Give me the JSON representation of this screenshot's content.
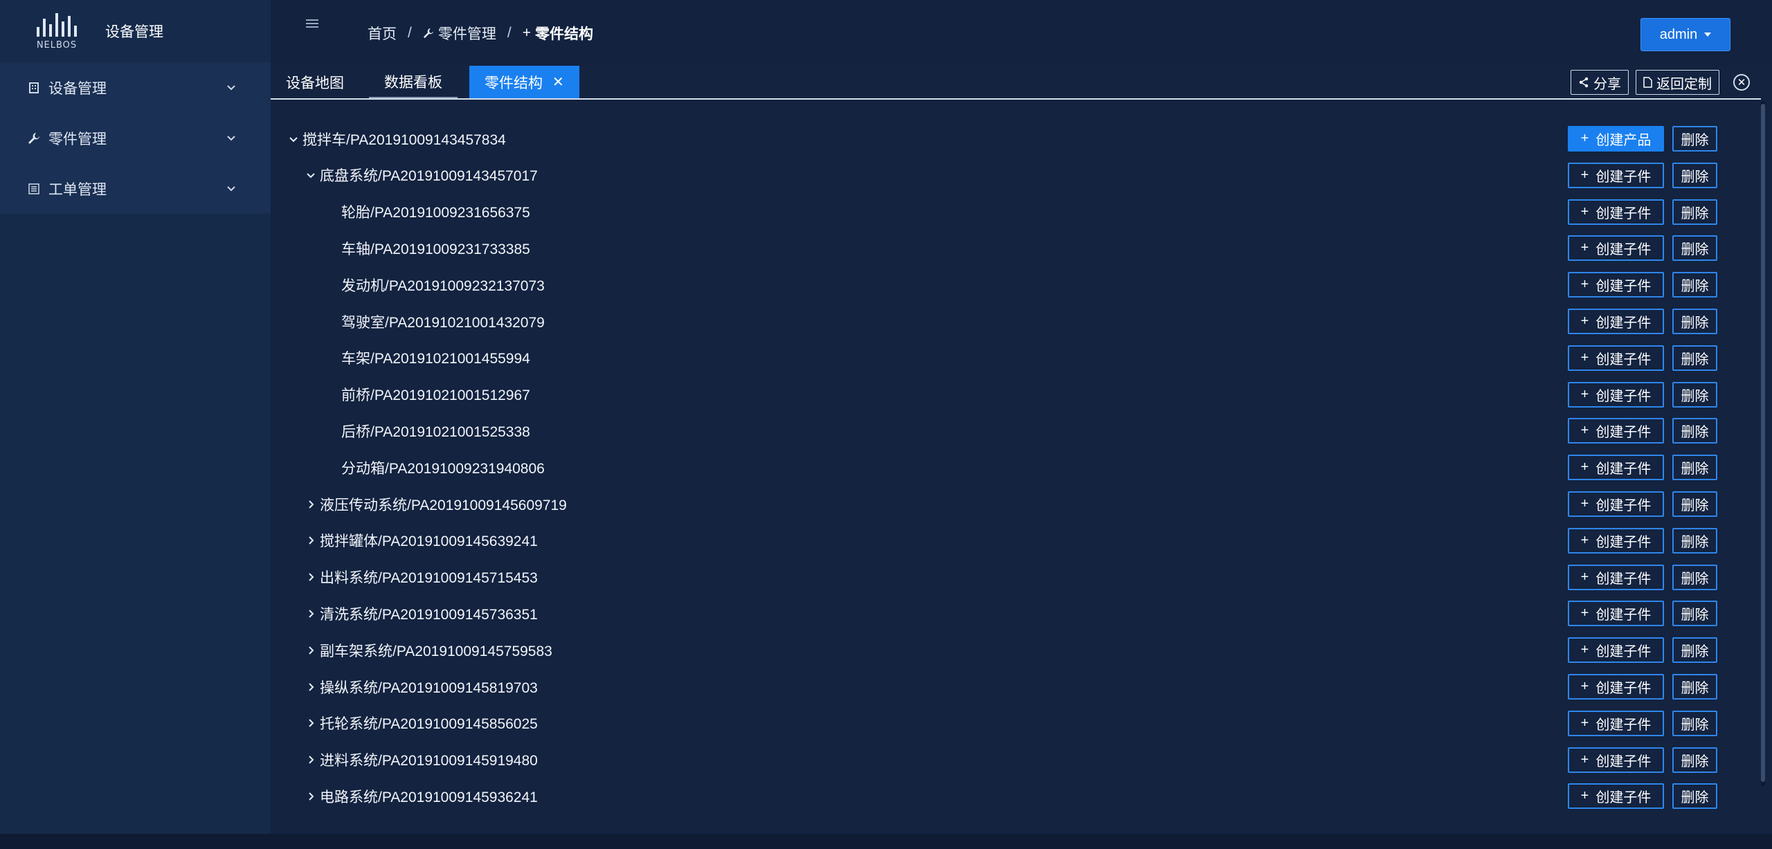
{
  "app": {
    "title": "设备管理",
    "logo_text": "NELBOS"
  },
  "sidebar": {
    "items": [
      {
        "label": "设备管理",
        "icon": "building-icon"
      },
      {
        "label": "零件管理",
        "icon": "wrench-icon"
      },
      {
        "label": "工单管理",
        "icon": "list-icon"
      }
    ]
  },
  "header": {
    "breadcrumb": [
      "首页",
      "零件管理",
      "零件结构"
    ],
    "user": "admin"
  },
  "tabs": {
    "items": [
      "设备地图",
      "数据看板",
      "零件结构"
    ],
    "share_label": "分享",
    "back_label": "返回定制"
  },
  "tree": {
    "create_product_label": "创建产品",
    "create_child_label": "创建子件",
    "delete_label": "删除",
    "nodes": [
      {
        "label": "搅拌车/PA20191009143457834",
        "expanded": true
      },
      {
        "label": "底盘系统/PA20191009143457017",
        "expanded": true
      },
      {
        "label": "轮胎/PA20191009231656375"
      },
      {
        "label": "车轴/PA20191009231733385"
      },
      {
        "label": "发动机/PA20191009232137073"
      },
      {
        "label": "驾驶室/PA20191021001432079"
      },
      {
        "label": "车架/PA20191021001455994"
      },
      {
        "label": "前桥/PA20191021001512967"
      },
      {
        "label": "后桥/PA20191021001525338"
      },
      {
        "label": "分动箱/PA20191009231940806"
      },
      {
        "label": "液压传动系统/PA20191009145609719",
        "expanded": false
      },
      {
        "label": "搅拌罐体/PA20191009145639241",
        "expanded": false
      },
      {
        "label": "出料系统/PA20191009145715453",
        "expanded": false
      },
      {
        "label": "清洗系统/PA20191009145736351",
        "expanded": false
      },
      {
        "label": "副车架系统/PA20191009145759583",
        "expanded": false
      },
      {
        "label": "操纵系统/PA20191009145819703",
        "expanded": false
      },
      {
        "label": "托轮系统/PA20191009145856025",
        "expanded": false
      },
      {
        "label": "进料系统/PA20191009145919480",
        "expanded": false
      },
      {
        "label": "电路系统/PA20191009145936241",
        "expanded": false
      }
    ]
  },
  "colors": {
    "accent": "#1a80f0",
    "bg": "#132340",
    "sidebar": "#152a49"
  }
}
